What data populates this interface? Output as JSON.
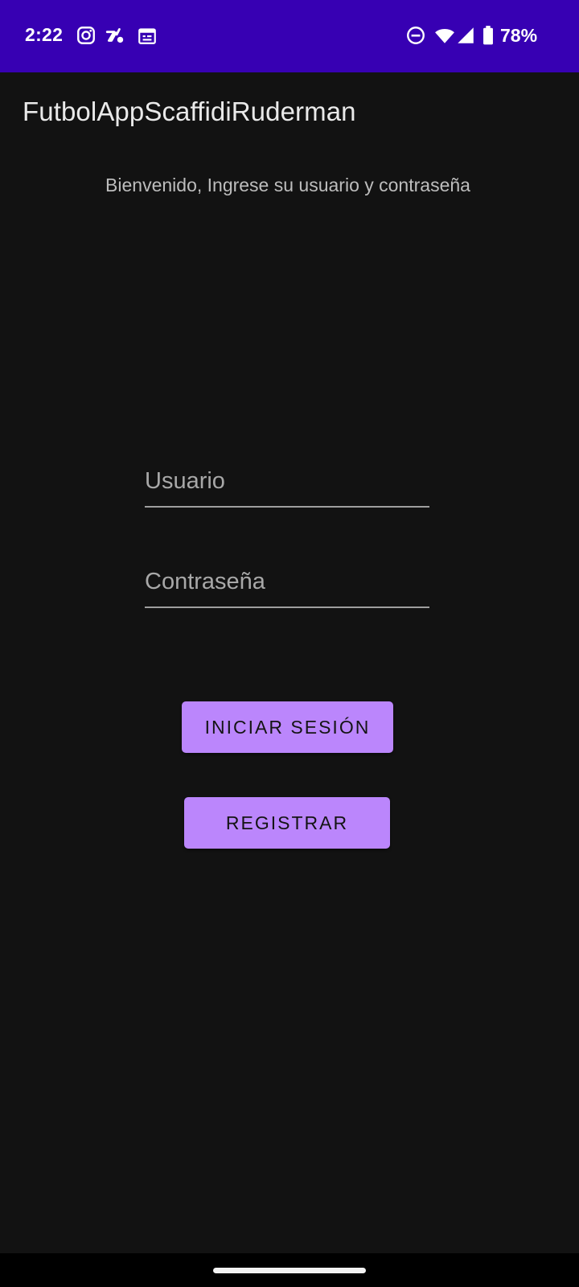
{
  "status_bar": {
    "time": "2:22",
    "battery_percent": "78%",
    "icons_left": [
      "instagram-icon",
      "strava-icon",
      "calendar-icon"
    ],
    "icons_right": [
      "do-not-disturb-icon",
      "wifi-icon",
      "signal-icon",
      "battery-icon"
    ],
    "background_color": "#3700b3"
  },
  "app_bar": {
    "title": "FutbolAppScaffidiRuderman"
  },
  "main": {
    "welcome": "Bienvenido, Ingrese su usuario y contraseña",
    "username_field": {
      "placeholder": "Usuario",
      "value": ""
    },
    "password_field": {
      "placeholder": "Contraseña",
      "value": ""
    },
    "login_button": "INICIAR SESIÓN",
    "register_button": "REGISTRAR",
    "accent_color": "#bb86fc",
    "background_color": "#121212"
  }
}
